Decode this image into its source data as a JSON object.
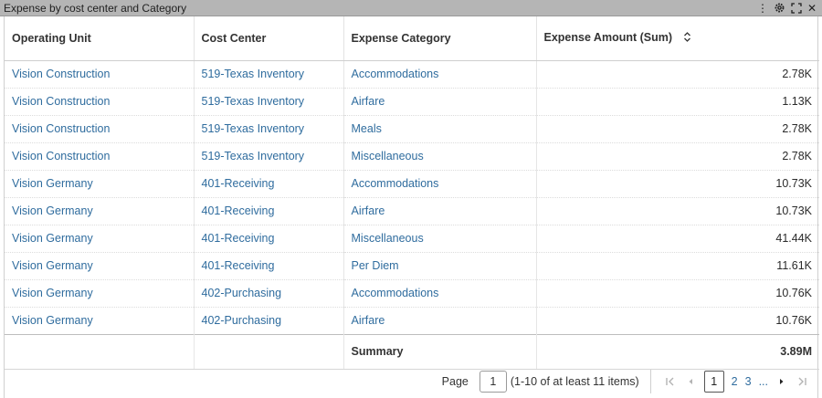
{
  "window": {
    "title": "Expense by cost center and Category",
    "actions": [
      {
        "icon": "more-vertical-icon",
        "glyph": "⋮"
      },
      {
        "icon": "gear-icon"
      },
      {
        "icon": "expand-icon",
        "glyph": "⛶"
      },
      {
        "icon": "close-icon",
        "glyph": "✕"
      }
    ]
  },
  "table": {
    "columns": [
      "Operating Unit",
      "Cost Center",
      "Expense Category",
      "Expense Amount (Sum)"
    ],
    "rows": [
      [
        "Vision Construction",
        "519-Texas Inventory",
        "Accommodations",
        "2.78K"
      ],
      [
        "Vision Construction",
        "519-Texas Inventory",
        "Airfare",
        "1.13K"
      ],
      [
        "Vision Construction",
        "519-Texas Inventory",
        "Meals",
        "2.78K"
      ],
      [
        "Vision Construction",
        "519-Texas Inventory",
        "Miscellaneous",
        "2.78K"
      ],
      [
        "Vision Germany",
        "401-Receiving",
        "Accommodations",
        "10.73K"
      ],
      [
        "Vision Germany",
        "401-Receiving",
        "Airfare",
        "10.73K"
      ],
      [
        "Vision Germany",
        "401-Receiving",
        "Miscellaneous",
        "41.44K"
      ],
      [
        "Vision Germany",
        "401-Receiving",
        "Per Diem",
        "11.61K"
      ],
      [
        "Vision Germany",
        "402-Purchasing",
        "Accommodations",
        "10.76K"
      ],
      [
        "Vision Germany",
        "402-Purchasing",
        "Airfare",
        "10.76K"
      ]
    ],
    "summary": {
      "label": "Summary",
      "value": "3.89M"
    }
  },
  "pager": {
    "page_label": "Page",
    "page_value": "1",
    "range_text": "(1-10 of at least 11 items)",
    "pages": [
      "1",
      "2",
      "3"
    ],
    "ellipsis": "...",
    "first_glyph": "|‹",
    "prev_glyph": "◂",
    "next_glyph": "▸",
    "last_glyph": "›|"
  },
  "colors": {
    "link": "#2f6c9e",
    "titlebar": "#b5b5b5"
  }
}
